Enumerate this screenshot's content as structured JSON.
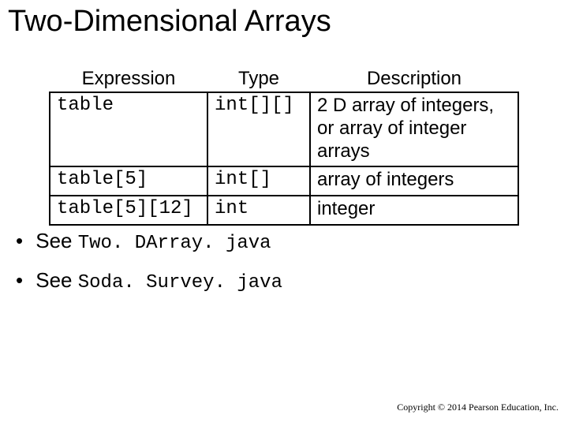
{
  "title": "Two-Dimensional Arrays",
  "headers": {
    "c1": "Expression",
    "c2": "Type",
    "c3": "Description"
  },
  "rows": [
    {
      "expr": "table",
      "type": "int[][]",
      "desc": "2 D array of integers, or array of integer arrays"
    },
    {
      "expr": "table[5]",
      "type": "int[]",
      "desc": "array of integers"
    },
    {
      "expr": "table[5][12]",
      "type": "int",
      "desc": "integer"
    }
  ],
  "bullets": {
    "b1_prefix": "See ",
    "b1_code": "Two. DArray. java",
    "b2_prefix": "See ",
    "b2_code": "Soda. Survey. java"
  },
  "footer": "Copyright © 2014 Pearson Education, Inc."
}
